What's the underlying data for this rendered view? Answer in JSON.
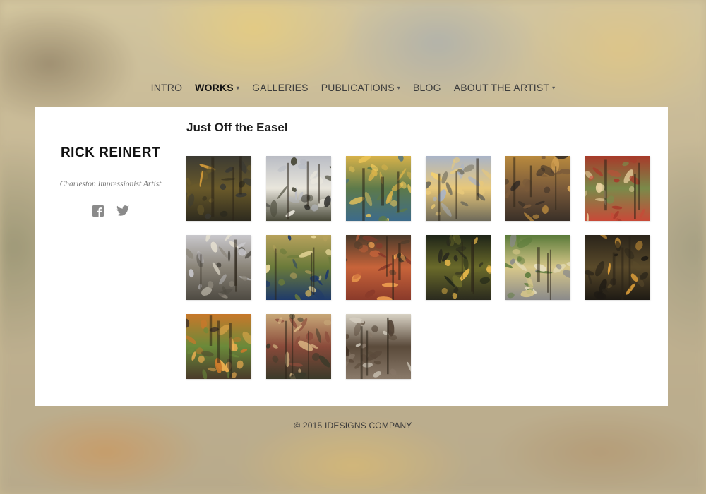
{
  "nav": {
    "items": [
      {
        "label": "INTRO",
        "active": false,
        "dropdown": false
      },
      {
        "label": "WORKS",
        "active": true,
        "dropdown": true
      },
      {
        "label": "GALLERIES",
        "active": false,
        "dropdown": false
      },
      {
        "label": "PUBLICATIONS",
        "active": false,
        "dropdown": true
      },
      {
        "label": "BLOG",
        "active": false,
        "dropdown": false
      },
      {
        "label": "ABOUT THE ARTIST",
        "active": false,
        "dropdown": true
      }
    ],
    "caret": "▾"
  },
  "sidebar": {
    "brand": "RICK REINERT",
    "tagline": "Charleston Impressionist Artist",
    "social": [
      {
        "icon": "facebook-icon"
      },
      {
        "icon": "twitter-icon"
      }
    ]
  },
  "main": {
    "title": "Just Off the Easel",
    "paintings": [
      {
        "sky": "#3b3a33",
        "mid": "#6a5a2a",
        "ground": "#2d2a1e",
        "accent": "#e0a23a"
      },
      {
        "sky": "#b9bcc4",
        "mid": "#e9e6dc",
        "ground": "#4a4a3a",
        "accent": "#2e2e2a"
      },
      {
        "sky": "#d7b24a",
        "mid": "#5d7a4a",
        "ground": "#3d6b8a",
        "accent": "#f0c85a"
      },
      {
        "sky": "#a9b4c8",
        "mid": "#e8c87a",
        "ground": "#6e6a5a",
        "accent": "#f4d070"
      },
      {
        "sky": "#b98a3e",
        "mid": "#7a5a3a",
        "ground": "#3a3028",
        "accent": "#e7b25c"
      },
      {
        "sky": "#a83a2a",
        "mid": "#7a8a4a",
        "ground": "#c84a38",
        "accent": "#e9d2a0"
      },
      {
        "sky": "#c9c8cc",
        "mid": "#8a8478",
        "ground": "#4e4a42",
        "accent": "#e8e2d2"
      },
      {
        "sky": "#b7a25c",
        "mid": "#6a7a3a",
        "ground": "#1e3a6a",
        "accent": "#e8d89a"
      },
      {
        "sky": "#4a3a2a",
        "mid": "#c8643a",
        "ground": "#8a3a2a",
        "accent": "#f0a050"
      },
      {
        "sky": "#1e2418",
        "mid": "#6a6a2a",
        "ground": "#2a2a1e",
        "accent": "#e8b84a"
      },
      {
        "sky": "#5a7a3a",
        "mid": "#d8c88a",
        "ground": "#8a8a8a",
        "accent": "#e8e0c0"
      },
      {
        "sky": "#2a241a",
        "mid": "#5a4a2a",
        "ground": "#1e1a14",
        "accent": "#e0a03a"
      },
      {
        "sky": "#c8782a",
        "mid": "#6a8a3a",
        "ground": "#4a3a2a",
        "accent": "#f0b050"
      },
      {
        "sky": "#c8a878",
        "mid": "#8a4a3a",
        "ground": "#3a3a2a",
        "accent": "#e8c890"
      },
      {
        "sky": "#d8d2c4",
        "mid": "#5a4a3a",
        "ground": "#8a7a6a",
        "accent": "#3a2a1e"
      }
    ]
  },
  "footer": {
    "copyright": "© 2015 IDESIGNS COMPANY"
  },
  "colors": {
    "card_bg": "#ffffff",
    "text": "#1b1b1b",
    "icon": "#8a8a8a"
  }
}
